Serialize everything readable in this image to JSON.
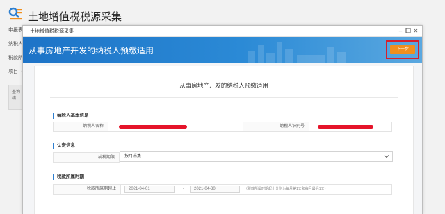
{
  "app": {
    "title": "土地增值税税源采集",
    "bg_labels": [
      "申报表",
      "纳税人",
      "税款所",
      "项目（"
    ],
    "bg_panel_label": "查询结"
  },
  "modal": {
    "title": "土地增值税税源采集",
    "banner_title": "从事房地产开发的纳税人预缴适用",
    "next_button": "下一步",
    "form_title": "从事房地产开发的纳税人预缴适用",
    "sections": {
      "basic": {
        "title": "纳税人基本信息",
        "name_label": "纳税人名称",
        "id_label": "纳税人识别号"
      },
      "identify": {
        "title": "认定信息",
        "period_label": "纳税期限",
        "period_value": "按月采集"
      },
      "tax_period": {
        "title": "税款所属时期",
        "label": "税款所属期起止",
        "start": "2021-04-01",
        "sep": "-",
        "end": "2021-04-30",
        "hint": "（税款所属时期起止分别为每月第1天和每月最后1天）"
      }
    }
  },
  "colors": {
    "banner": "#1d73c7",
    "next_button": "#f08f1e",
    "highlight": "#d61f2c",
    "redaction": "#e5142a",
    "accent": "#2e7fd0"
  }
}
